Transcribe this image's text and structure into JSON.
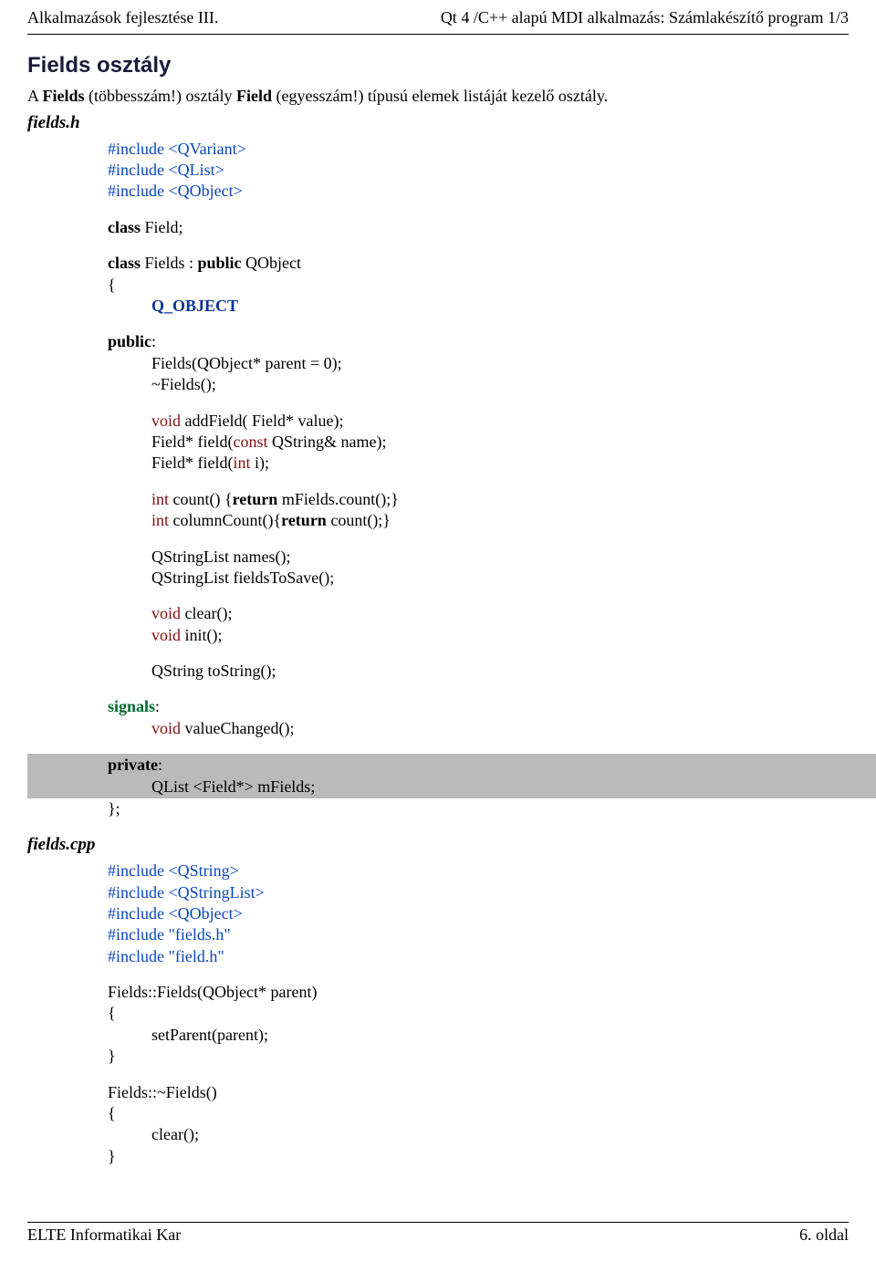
{
  "header": {
    "left": "Alkalmazások fejlesztése III.",
    "right": "Qt 4 /C++ alapú MDI alkalmazás: Számlakészítő program 1/3"
  },
  "section_title": "Fields osztály",
  "intro": {
    "pre": "A ",
    "cls1": "Fields",
    "mid1": " (többesszám!) osztály ",
    "cls2": "Field",
    "mid2": " (egyesszám!) típusú elemek listáját kezelő osztály."
  },
  "file_h": "fields.h",
  "file_cpp": "fields.cpp",
  "code": {
    "inc1": "#include <QVariant>",
    "inc2": "#include <QList>",
    "inc3": "#include <QObject>",
    "classField": "class",
    "classFieldR": " Field;",
    "classFields": "class",
    "classFieldsR": " Fields : ",
    "publicKw": "public",
    "qobject": " QObject",
    "lbrace": "{",
    "qobj_macro": "Q_OBJECT",
    "publicColon": "public",
    "colon": ":",
    "ctor": "Fields(QObject* parent = 0);",
    "dtor": "~Fields();",
    "voidKw": "void",
    "addField": " addField( Field* value);",
    "fieldPtr": "Field* field(",
    "constKw": "const",
    "qstringName": " QString& name);",
    "fieldInt1": "Field* field(",
    "intKw": "int",
    "fieldInt2": " i);",
    "intCount1": "int",
    "intCount2": " count() {",
    "returnKw": "return",
    "intCount3": " mFields.count();}",
    "colCount1": "int",
    "colCount2": " columnCount(){",
    "colCount3": " count();}",
    "names": "QStringList names();",
    "fieldsToSave": "QStringList fieldsToSave();",
    "clear": " clear();",
    "init": " init();",
    "toString": "QString toString();",
    "signals": "signals",
    "valueChanged": " valueChanged();",
    "privateKw": "private",
    "mFields": "QList <Field*> mFields;",
    "classEnd": "};",
    "incC1": "#include <QString>",
    "incC2": "#include <QStringList>",
    "incC3": "#include <QObject>",
    "incC4": "#include \"fields.h\"",
    "incC5": "#include \"field.h\"",
    "ctorImpl": "Fields::Fields(QObject* parent)",
    "setParent": "setParent(parent);",
    "rbrace": "}",
    "dtorImpl": "Fields::~Fields()",
    "clearCall": "clear();"
  },
  "footer": {
    "left": "ELTE Informatikai Kar",
    "right": "6. oldal"
  }
}
